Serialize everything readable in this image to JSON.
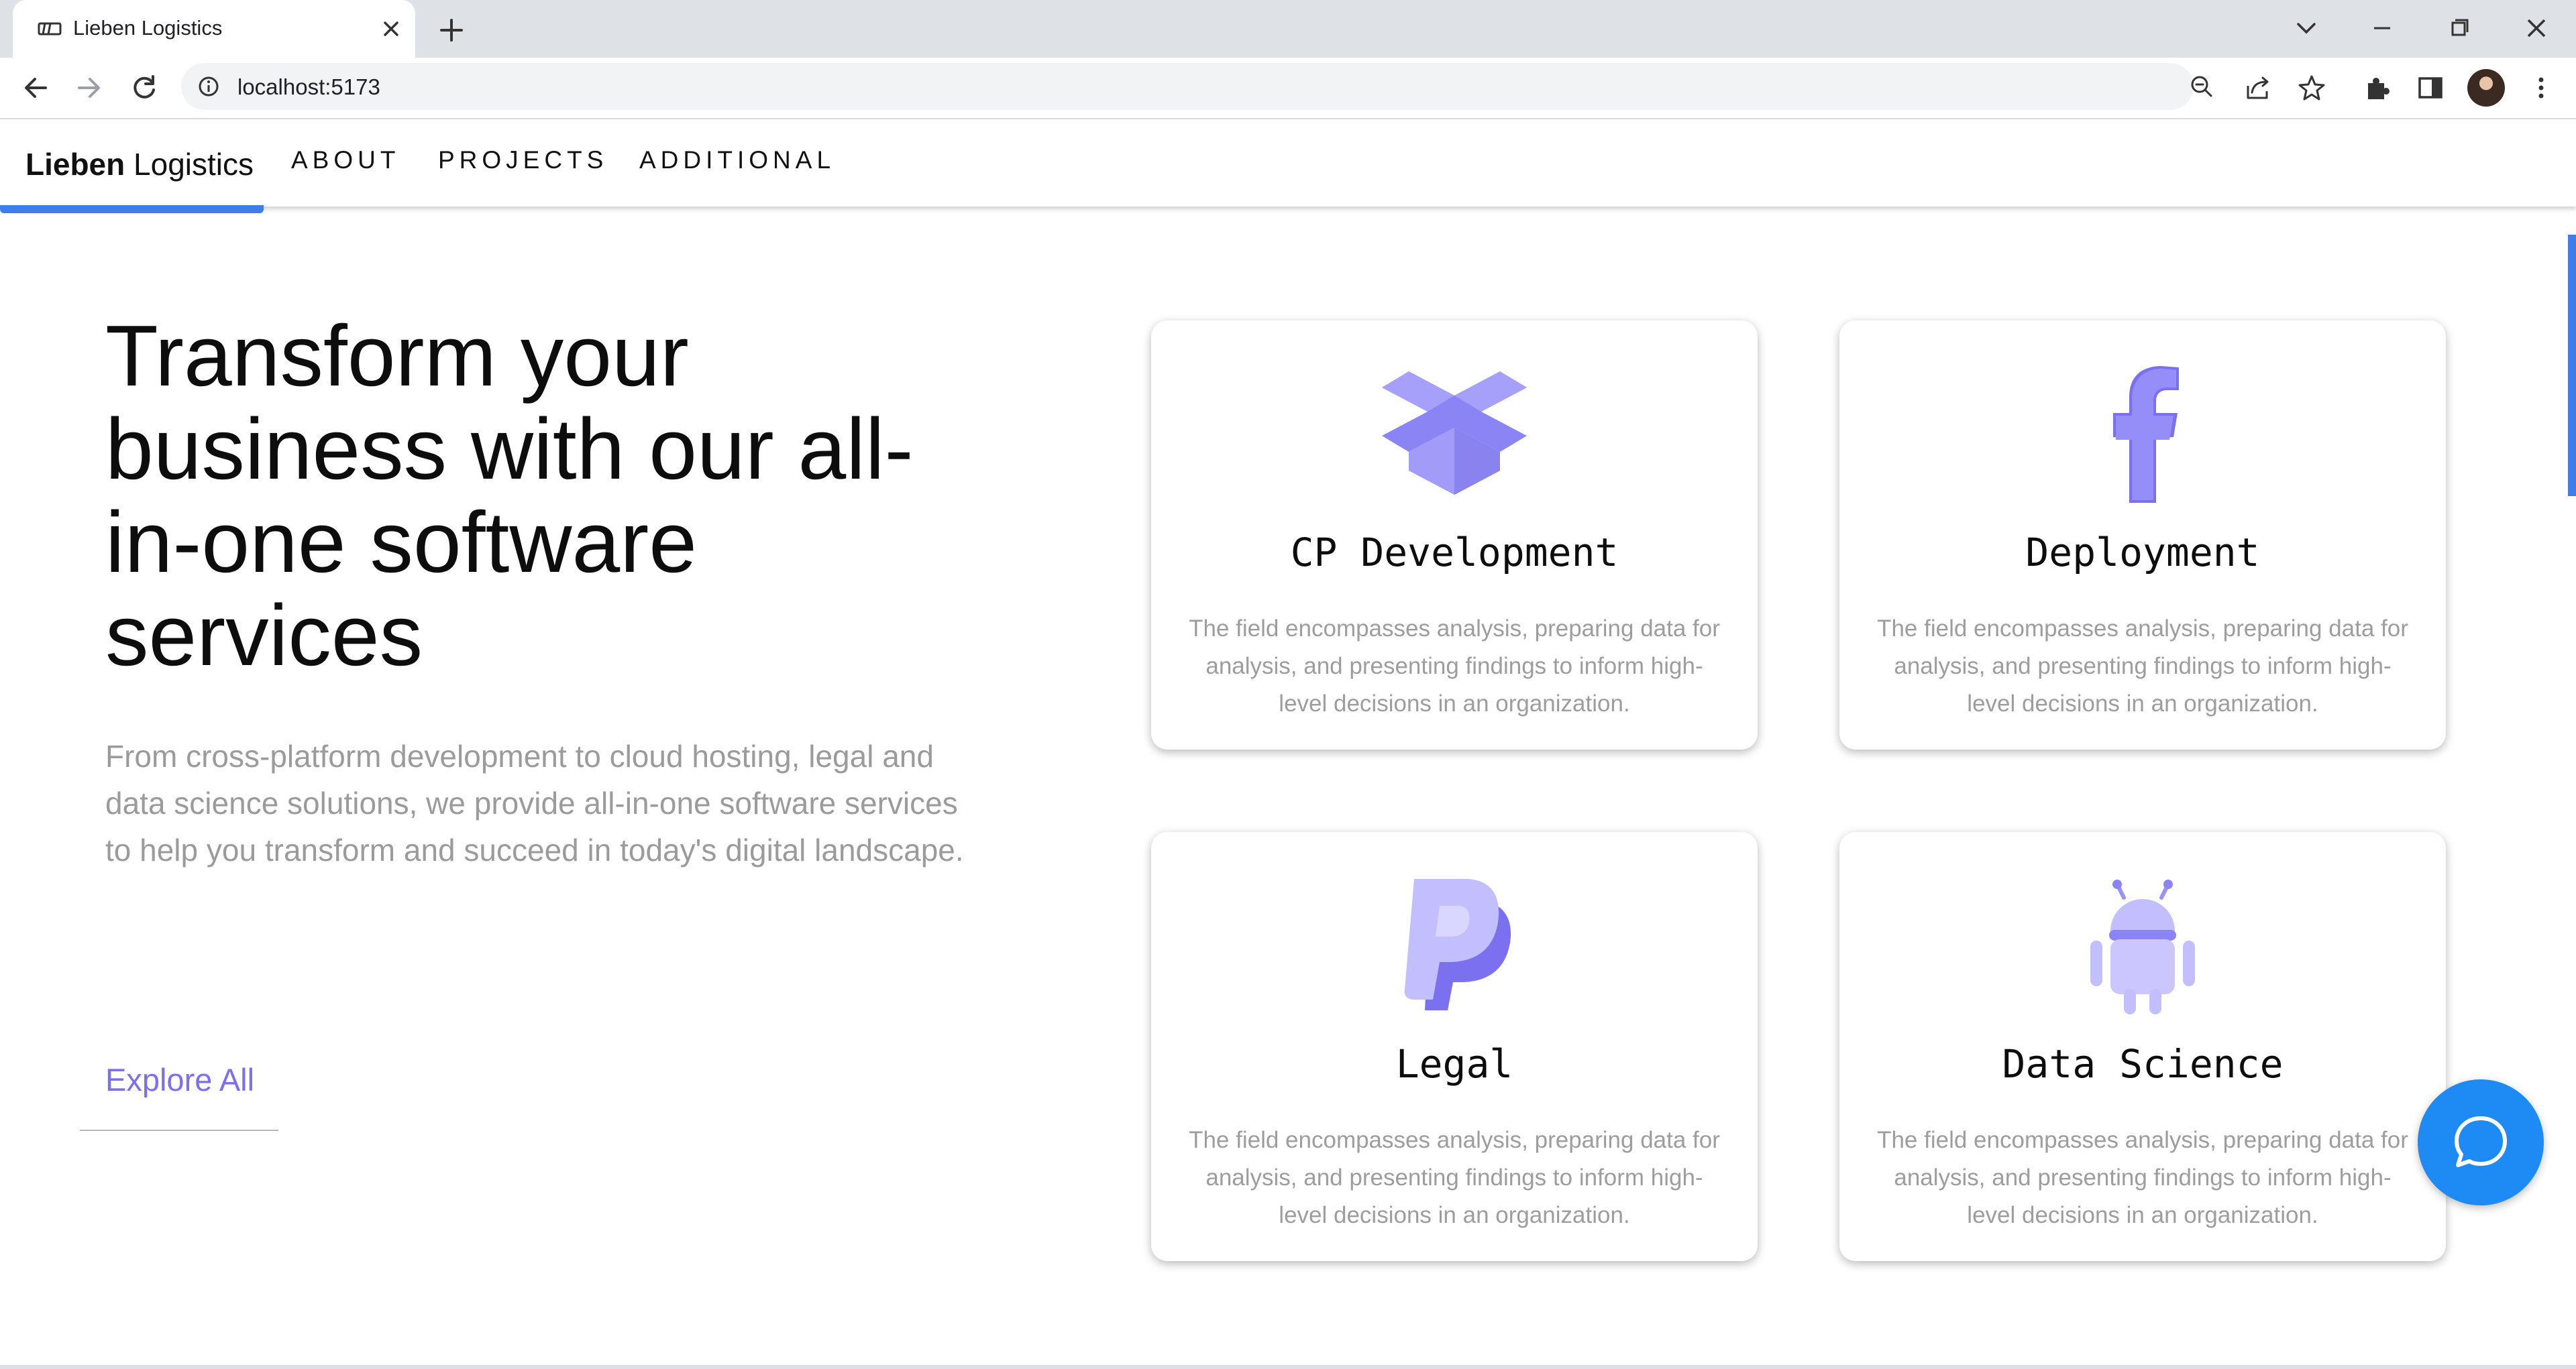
{
  "browser": {
    "tab_title": "Lieben Logistics",
    "url": "localhost:5173"
  },
  "site": {
    "brand_bold": "Lieben",
    "brand_regular": "Logistics",
    "nav": [
      "ABOUT",
      "PROJECTS",
      "ADDITIONAL"
    ]
  },
  "hero": {
    "title_lines": [
      "Transform your",
      "business with our all-",
      "in-one software",
      "services"
    ],
    "description": "From cross-platform development to cloud hosting, legal and data science solutions, we provide all-in-one software services to help you transform and succeed in today's digital landscape.",
    "cta": "Explore All"
  },
  "cards": [
    {
      "icon": "dropbox-icon",
      "title": "CP Development",
      "description": "The field encompasses analysis, preparing data for analysis, and presenting findings to inform high-level decisions in an organization."
    },
    {
      "icon": "facebook-icon",
      "title": "Deployment",
      "description": "The field encompasses analysis, preparing data for analysis, and presenting findings to inform high-level decisions in an organization."
    },
    {
      "icon": "paypal-icon",
      "title": "Legal",
      "description": "The field encompasses analysis, preparing data for analysis, and presenting findings to inform high-level decisions in an organization."
    },
    {
      "icon": "android-icon",
      "title": "Data Science",
      "description": "The field encompasses analysis, preparing data for analysis, and presenting findings to inform high-level decisions in an organization."
    }
  ],
  "colors": {
    "accent": "#7b6ff2",
    "icon_purple": "#8b84f5",
    "brand_blue": "#3f7ee8",
    "chat_button": "#1e8bf5"
  }
}
